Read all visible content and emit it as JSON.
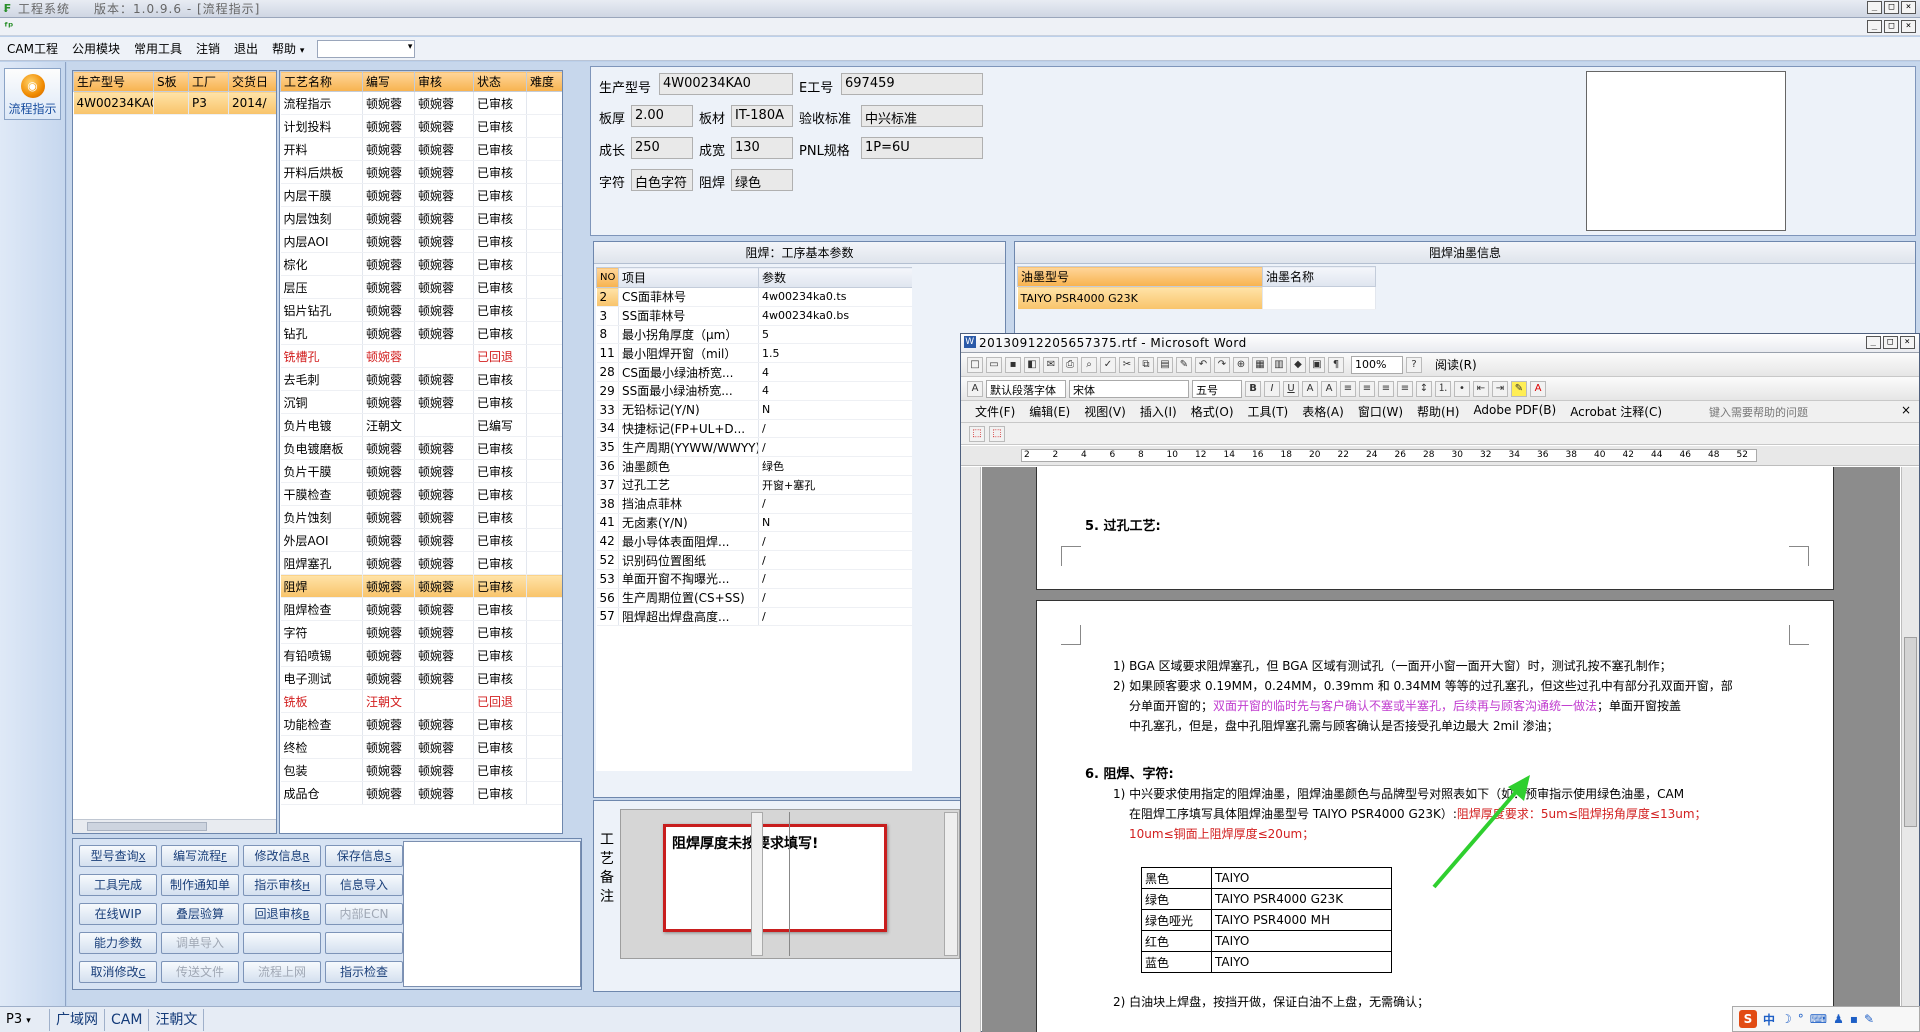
{
  "app": {
    "title": "工程系统",
    "version": "版本：1.0.9.6 - [流程指示]",
    "logo_glyph": "ᵢᵖ"
  },
  "menu": {
    "items": [
      "CAM工程",
      "公用模块",
      "常用工具",
      "注销",
      "退出",
      "帮助"
    ],
    "combo_value": ""
  },
  "left_strip": {
    "flow_button_label": "流程指示",
    "icon": "flow-indicator-icon"
  },
  "production_list": {
    "headers": [
      "生产型号",
      "S板",
      "工厂",
      "交货日"
    ],
    "rows": [
      [
        "4W00234KA0",
        "",
        "P3",
        "2014/"
      ]
    ]
  },
  "process_list": {
    "headers": [
      "工艺名称",
      "编写",
      "审核",
      "状态",
      "难度"
    ],
    "rows": [
      [
        "流程指示",
        "顿婉蓉",
        "顿婉蓉",
        "已审核",
        ""
      ],
      [
        "计划投料",
        "顿婉蓉",
        "顿婉蓉",
        "已审核",
        ""
      ],
      [
        "开料",
        "顿婉蓉",
        "顿婉蓉",
        "已审核",
        ""
      ],
      [
        "开料后烘板",
        "顿婉蓉",
        "顿婉蓉",
        "已审核",
        ""
      ],
      [
        "内层干膜",
        "顿婉蓉",
        "顿婉蓉",
        "已审核",
        ""
      ],
      [
        "内层蚀刻",
        "顿婉蓉",
        "顿婉蓉",
        "已审核",
        ""
      ],
      [
        "内层AOI",
        "顿婉蓉",
        "顿婉蓉",
        "已审核",
        ""
      ],
      [
        "棕化",
        "顿婉蓉",
        "顿婉蓉",
        "已审核",
        ""
      ],
      [
        "层压",
        "顿婉蓉",
        "顿婉蓉",
        "已审核",
        ""
      ],
      [
        "铝片钻孔",
        "顿婉蓉",
        "顿婉蓉",
        "已审核",
        ""
      ],
      [
        "钻孔",
        "顿婉蓉",
        "顿婉蓉",
        "已审核",
        ""
      ],
      [
        "铣槽孔",
        "顿婉蓉",
        "",
        "已回退",
        ""
      ],
      [
        "去毛刺",
        "顿婉蓉",
        "顿婉蓉",
        "已审核",
        ""
      ],
      [
        "沉铜",
        "顿婉蓉",
        "顿婉蓉",
        "已审核",
        ""
      ],
      [
        "负片电镀",
        "汪朝文",
        "",
        "已编写",
        ""
      ],
      [
        "负电镀磨板",
        "顿婉蓉",
        "顿婉蓉",
        "已审核",
        ""
      ],
      [
        "负片干膜",
        "顿婉蓉",
        "顿婉蓉",
        "已审核",
        ""
      ],
      [
        "干膜检查",
        "顿婉蓉",
        "顿婉蓉",
        "已审核",
        ""
      ],
      [
        "负片蚀刻",
        "顿婉蓉",
        "顿婉蓉",
        "已审核",
        ""
      ],
      [
        "外层AOI",
        "顿婉蓉",
        "顿婉蓉",
        "已审核",
        ""
      ],
      [
        "阻焊塞孔",
        "顿婉蓉",
        "顿婉蓉",
        "已审核",
        ""
      ],
      [
        "阻焊",
        "顿婉蓉",
        "顿婉蓉",
        "已审核",
        ""
      ],
      [
        "阻焊检查",
        "顿婉蓉",
        "顿婉蓉",
        "已审核",
        ""
      ],
      [
        "字符",
        "顿婉蓉",
        "顿婉蓉",
        "已审核",
        ""
      ],
      [
        "有铅喷锡",
        "顿婉蓉",
        "顿婉蓉",
        "已审核",
        ""
      ],
      [
        "电子测试",
        "顿婉蓉",
        "顿婉蓉",
        "已审核",
        ""
      ],
      [
        "铣板",
        "汪朝文",
        "",
        "已回退",
        ""
      ],
      [
        "功能检查",
        "顿婉蓉",
        "顿婉蓉",
        "已审核",
        ""
      ],
      [
        "终检",
        "顿婉蓉",
        "顿婉蓉",
        "已审核",
        ""
      ],
      [
        "包装",
        "顿婉蓉",
        "顿婉蓉",
        "已审核",
        ""
      ],
      [
        "成品仓",
        "顿婉蓉",
        "顿婉蓉",
        "已审核",
        ""
      ]
    ],
    "selected_index": 21,
    "red_rows": [
      11,
      26
    ]
  },
  "info": {
    "prod_model_label": "生产型号",
    "prod_model": "4W00234KA0",
    "e_no_label": "E工号",
    "e_no": "697459",
    "thickness_label": "板厚",
    "thickness": "2.00",
    "material_label": "板材",
    "material": "IT-180A",
    "std_label": "验收标准",
    "std": "中兴标准",
    "length_label": "成长",
    "length": "250",
    "width_label": "成宽",
    "width": "130",
    "pnl_label": "PNL规格",
    "pnl": "1P=6U",
    "char_label": "字符",
    "char": "白色字符",
    "mask_label": "阻焊",
    "mask": "绿色"
  },
  "params": {
    "title": "阻焊：工序基本参数",
    "headers": [
      "NO",
      "项目",
      "参数"
    ],
    "rows": [
      [
        "2",
        "CS面菲林号",
        "4w00234ka0.ts"
      ],
      [
        "3",
        "SS面菲林号",
        "4w00234ka0.bs"
      ],
      [
        "8",
        "最小拐角厚度（μm）",
        "5"
      ],
      [
        "11",
        "最小阻焊开窗（mil）",
        "1.5"
      ],
      [
        "28",
        "CS面最小绿油桥宽...",
        "4"
      ],
      [
        "29",
        "SS面最小绿油桥宽...",
        "4"
      ],
      [
        "33",
        "无铅标记(Y/N)",
        "N"
      ],
      [
        "34",
        "快捷标记(FP+UL+D...",
        "/"
      ],
      [
        "35",
        "生产周期(YYWW/WWYY)",
        "/"
      ],
      [
        "36",
        "油墨颜色",
        "绿色"
      ],
      [
        "37",
        "过孔工艺",
        "开窗+塞孔"
      ],
      [
        "38",
        "挡油点菲林",
        "/"
      ],
      [
        "41",
        "无卤素(Y/N)",
        "N"
      ],
      [
        "42",
        "最小导体表面阻焊...",
        "/"
      ],
      [
        "52",
        "识别码位置图纸",
        "/"
      ],
      [
        "53",
        "单面开窗不掏曝光...",
        "/"
      ],
      [
        "56",
        "生产周期位置(CS+SS)",
        "/"
      ],
      [
        "57",
        "阻焊超出焊盘高度...",
        "/"
      ]
    ],
    "selected_index": 0
  },
  "ink": {
    "title": "阻焊油墨信息",
    "headers": [
      "油墨型号",
      "油墨名称"
    ],
    "rows": [
      [
        "TAIYO   PSR4000 G23K",
        ""
      ]
    ]
  },
  "remark": {
    "label": "工艺备注",
    "note": "阻焊厚度未按要求填写!"
  },
  "buttons": [
    {
      "label": "型号查询",
      "key": "X",
      "enabled": true
    },
    {
      "label": "编写流程",
      "key": "F",
      "enabled": true
    },
    {
      "label": "修改信息",
      "key": "R",
      "enabled": true
    },
    {
      "label": "保存信息",
      "key": "S",
      "enabled": true
    },
    {
      "label": "工具完成",
      "key": "",
      "enabled": true
    },
    {
      "label": "制作通知单",
      "key": "",
      "enabled": true
    },
    {
      "label": "指示审核",
      "key": "H",
      "enabled": true
    },
    {
      "label": "信息导入",
      "key": "",
      "enabled": true
    },
    {
      "label": "在线WIP",
      "key": "",
      "enabled": true
    },
    {
      "label": "叠层验算",
      "key": "",
      "enabled": true
    },
    {
      "label": "回退审核",
      "key": "B",
      "enabled": true
    },
    {
      "label": "内部ECN",
      "key": "",
      "enabled": false
    },
    {
      "label": "能力参数",
      "key": "",
      "enabled": true
    },
    {
      "label": "调单导入",
      "key": "",
      "enabled": false
    },
    {
      "label": "",
      "key": "",
      "enabled": false
    },
    {
      "label": "",
      "key": "",
      "enabled": false
    },
    {
      "label": "取消修改",
      "key": "C",
      "enabled": true
    },
    {
      "label": "传送文件",
      "key": "",
      "enabled": false
    },
    {
      "label": "流程上网",
      "key": "",
      "enabled": false
    },
    {
      "label": "指示检查",
      "key": "",
      "enabled": true
    }
  ],
  "status_bar": {
    "factory": "P3",
    "tabs": [
      "广域网",
      "CAM",
      "汪朝文"
    ]
  },
  "word": {
    "title": "20130912205657375.rtf - Microsoft Word",
    "style": "默认段落字体",
    "font": "宋体",
    "size": "五号",
    "zoom": "100%",
    "read_btn": "阅读(R)",
    "menus": [
      "文件(F)",
      "编辑(E)",
      "视图(V)",
      "插入(I)",
      "格式(O)",
      "工具(T)",
      "表格(A)",
      "窗口(W)",
      "帮助(H)",
      "Adobe PDF(B)",
      "Acrobat 注释(C)"
    ],
    "help_box": "键入需要帮助的问题",
    "ruler": [
      "2",
      "2",
      "4",
      "6",
      "8",
      "10",
      "12",
      "14",
      "16",
      "18",
      "20",
      "22",
      "24",
      "26",
      "28",
      "30",
      "32",
      "34",
      "36",
      "38",
      "40",
      "42",
      "44",
      "46",
      "48",
      "52"
    ],
    "page1": {
      "heading": "5.  过孔工艺:"
    },
    "page2": {
      "l1": "1)  BGA 区域要求阻焊塞孔，但 BGA 区域有测试孔（一面开小窗一面开大窗）时，测试孔按不塞孔制作；",
      "l2a": "2)  如果顾客要求 0.19MM，0.24MM，0.39mm 和 0.34MM 等等的过孔塞孔，但这些过孔中有部分孔双面开窗，部",
      "l2b_black": "分单面开窗的；",
      "l2b_purple": "双面开窗的临时先与客户确认不塞或半塞孔，后续再与顾客沟通统一做法",
      "l2b_rest": "；单面开窗按盖",
      "l2c": "中孔塞孔，但是，盘中孔阻焊塞孔需与顾客确认是否接受孔单边最大 2mil 渗油；",
      "heading6": "6.  阻焊、字符:",
      "l3a": "1)  中兴要求使用指定的阻焊油墨，阻焊油墨颜色与品牌型号对照表如下（如：预审指示使用绿色油墨，CAM",
      "l3b_black": "在阻焊工序填写具体阻焊油墨型号 TAIYO  PSR4000 G23K）:",
      "l3b_red": "阻焊厚度要求：5um≤阻焊拐角厚度≤13um；",
      "l3c_red": "10um≤铜面上阻焊厚度≤20um；",
      "table": [
        [
          "黑色",
          "TAIYO"
        ],
        [
          "绿色",
          "TAIYO    PSR4000 G23K"
        ],
        [
          "绿色哑光",
          "TAIYO    PSR4000 MH"
        ],
        [
          "红色",
          "TAIYO"
        ],
        [
          "蓝色",
          "TAIYO"
        ]
      ],
      "l4": "2)  白油块上焊盘，按挡开做，保证白油不上盘，无需确认；"
    }
  },
  "tray": {
    "ime": "中"
  },
  "colors": {
    "accent_orange": "#f7b24e",
    "red_text": "#d21f1f",
    "purple_text": "#c03ccf",
    "arrow_green": "#2fcf2f",
    "note_border": "#c81e1e"
  }
}
